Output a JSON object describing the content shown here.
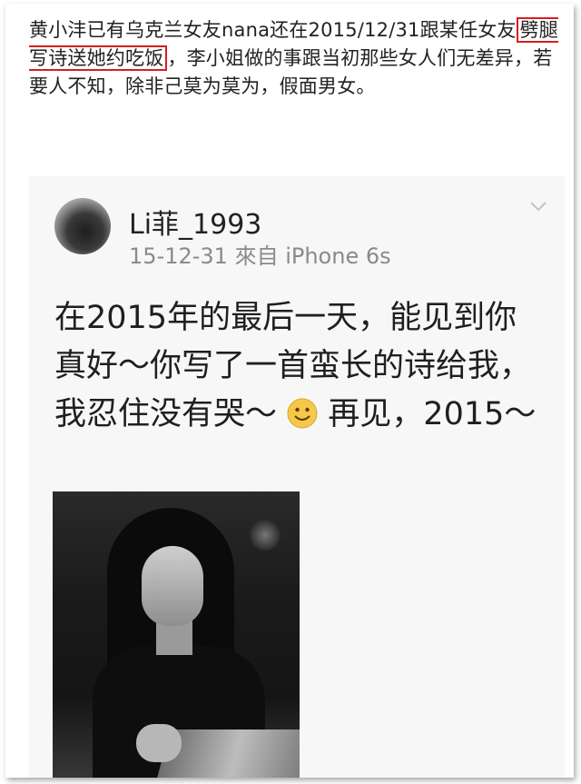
{
  "caption": {
    "before": "黄小沣已有乌克兰女友nana还在2015/12/31跟某任女友",
    "highlight": "劈腿写诗送她约吃饭",
    "after": "，李小姐做的事跟当初那些女人们无差异，若要人不知，除非己莫为莫为，假面男女。"
  },
  "post": {
    "username": "Li菲_1993",
    "meta": "15-12-31 來自 iPhone 6s",
    "text_part1": "在2015年的最后一天，能见到你真好～你写了一首蛮长的诗给我，我忍住没有哭～",
    "text_part2": "再见，2015～",
    "emoji": "smile-emoji"
  },
  "colors": {
    "highlight_border": "#d81e1e",
    "card_bg": "#f7f7f7",
    "meta_text": "#8a8a8a"
  }
}
